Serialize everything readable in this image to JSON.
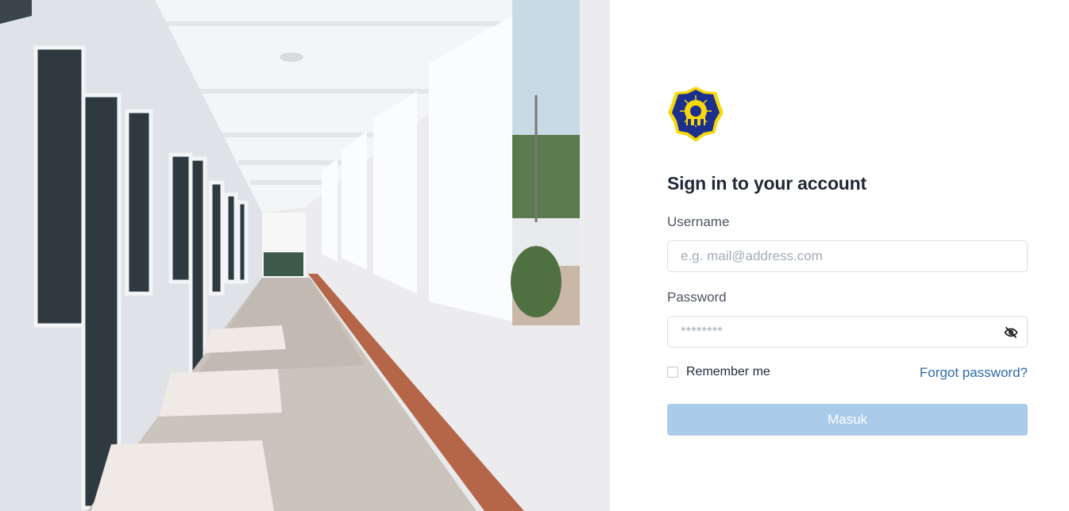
{
  "hero": {
    "image": "school-corridor-photo"
  },
  "logo": {
    "icon": "school-emblem-icon",
    "colors": {
      "border": "#f5d90a",
      "fill": "#1c2f8f"
    }
  },
  "form": {
    "title": "Sign in to your account",
    "username": {
      "label": "Username",
      "placeholder": "e.g. mail@address.com",
      "value": ""
    },
    "password": {
      "label": "Password",
      "placeholder": "********",
      "value": "",
      "toggle_icon": "eye-off-icon"
    },
    "remember": {
      "label": "Remember me",
      "checked": false
    },
    "forgot_label": "Forgot password?",
    "submit_label": "Masuk"
  },
  "colors": {
    "accent": "#2d6ca8",
    "button_bg": "#abcbea",
    "title": "#1f2937"
  }
}
